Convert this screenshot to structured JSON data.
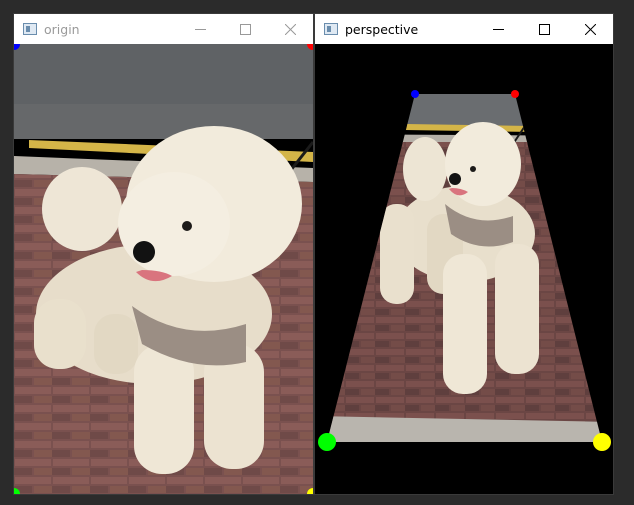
{
  "windows": {
    "origin": {
      "title": "origin",
      "title_color": "#9a9a9a",
      "controls": [
        "minimize-icon",
        "maximize-icon",
        "close-icon"
      ]
    },
    "perspective": {
      "title": "perspective",
      "title_color": "#000000",
      "controls": [
        "minimize-icon",
        "maximize-icon",
        "close-icon"
      ]
    }
  },
  "marker_colors": {
    "top_left": "#0000ff",
    "top_right": "#ff0000",
    "bottom_left": "#00ff00",
    "bottom_right": "#ffff00"
  },
  "image": {
    "subject": "white poodle on brick sidewalk",
    "colors": {
      "road": "#5f6265",
      "curb": "#b7b2a9",
      "stripe": "#d4b548",
      "brick": "#7d5552",
      "dog": "#ece4d3",
      "harness": "#9b8e84"
    }
  }
}
